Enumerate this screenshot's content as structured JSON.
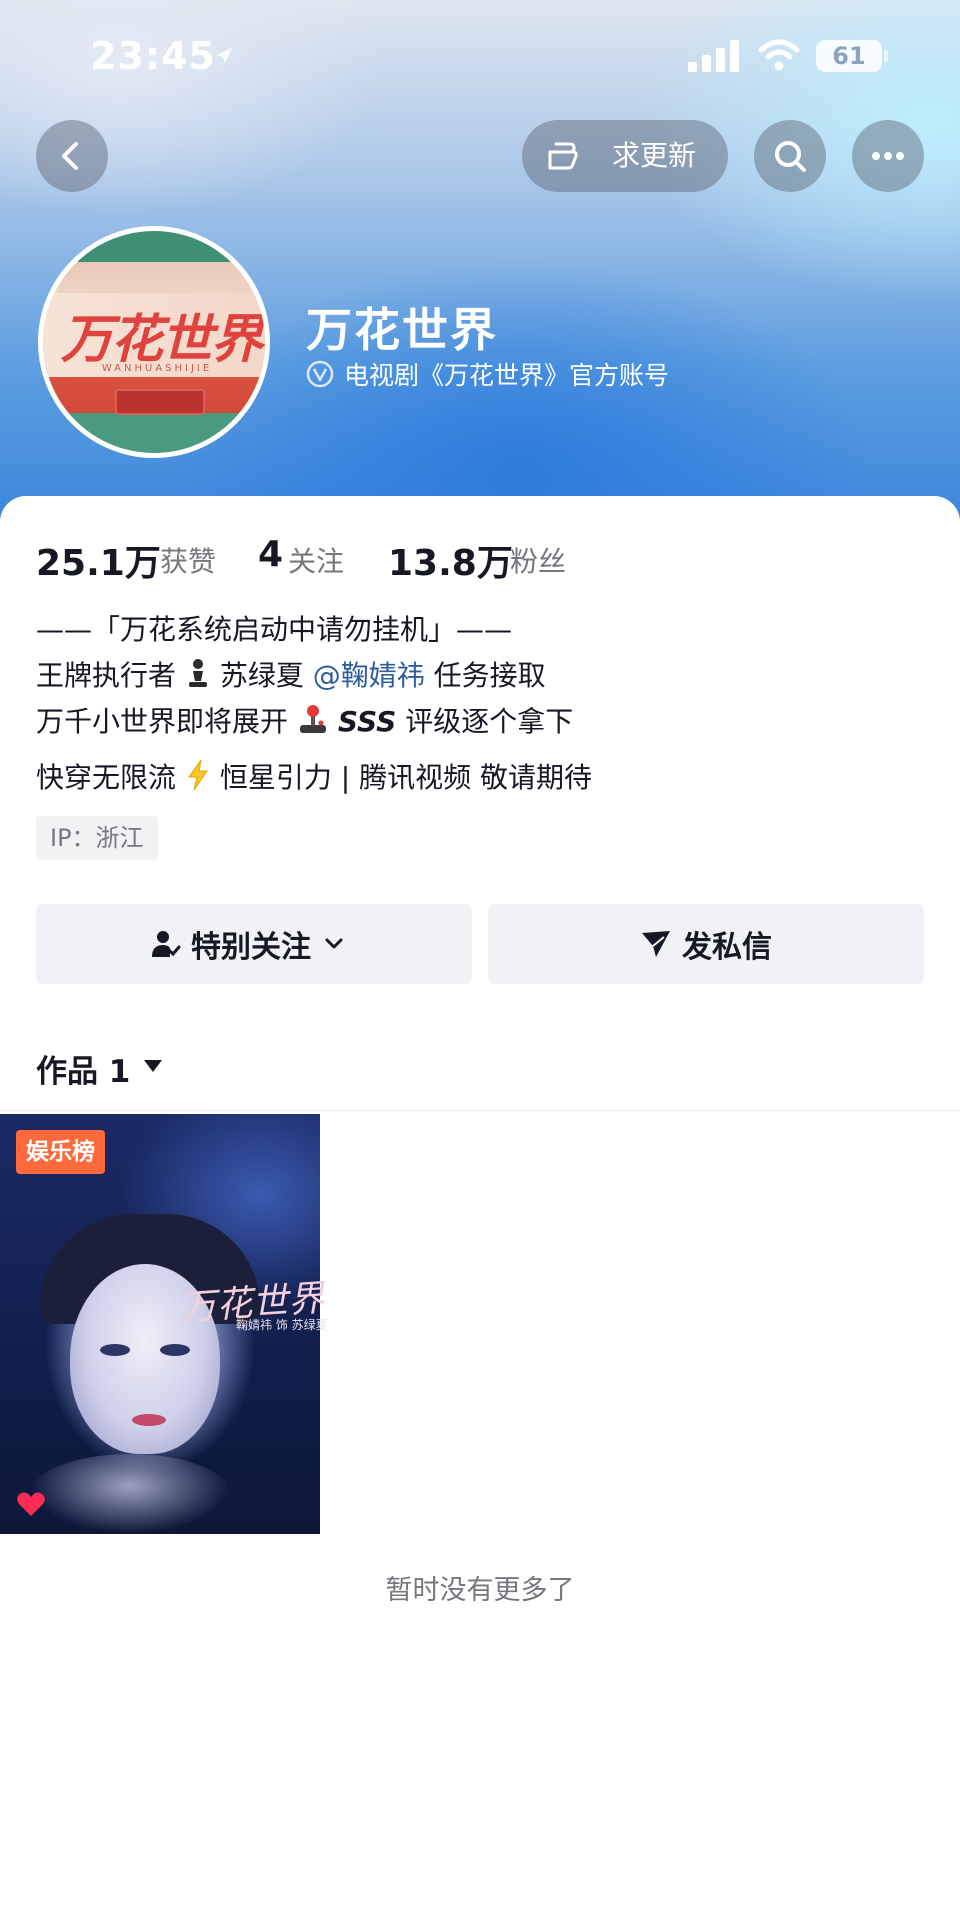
{
  "status_bar": {
    "time": "23:45",
    "battery": "61"
  },
  "nav": {
    "request_update_label": "求更新"
  },
  "profile": {
    "avatar_title": "万花世界",
    "avatar_subtitle": "WANHUASHIJIE",
    "name": "万花世界",
    "verified_text": "电视剧《万花世界》官方账号"
  },
  "stats": {
    "likes_value": "25.1万",
    "likes_label": "获赞",
    "following_value": "4",
    "following_label": "关注",
    "followers_value": "13.8万",
    "followers_label": "粉丝"
  },
  "bio": {
    "line1": "——「万花系统启动中请勿挂机」——",
    "line2_a": "王牌执行者",
    "line2_b": "苏绿夏",
    "line2_mention": "@鞠婧祎",
    "line2_c": "任务接取",
    "line3_a": "万千小世界即将展开",
    "line3_b": "SSS",
    "line3_c": "评级逐个拿下",
    "line4_a": "快穿无限流",
    "line4_b": "恒星引力 | 腾讯视频 敬请期待",
    "ip": "IP：浙江"
  },
  "actions": {
    "follow_label": "特别关注",
    "message_label": "发私信"
  },
  "works": {
    "title": "作品 1",
    "items": [
      {
        "tag": "娱乐榜",
        "poster_title": "万花世界",
        "poster_sub": "鞠婧祎 饰 苏绿夏"
      }
    ],
    "end_text": "暂时没有更多了"
  },
  "colors": {
    "accent_tag": "#fe6a3c",
    "mention": "#2f5e9a",
    "heart": "#fe2c55"
  }
}
